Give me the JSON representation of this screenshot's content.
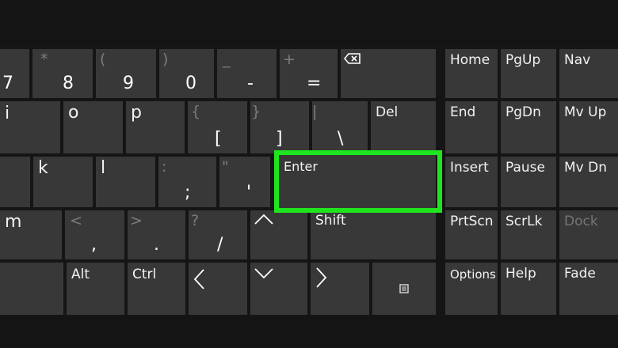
{
  "keys": {
    "seven": "7",
    "eight_top": "*",
    "eight": "8",
    "nine_top": "(",
    "nine": "9",
    "zero_top": ")",
    "zero": "0",
    "minus_top": "_",
    "minus": "-",
    "equals_top": "+",
    "equals": "=",
    "i": "i",
    "o": "o",
    "p": "p",
    "lbracket_top": "{",
    "lbracket": "[",
    "rbracket_top": "}",
    "rbracket": "]",
    "backslash_top": "|",
    "backslash": "\\",
    "del": "Del",
    "k": "k",
    "l": "l",
    "semicolon_top": ":",
    "semicolon": ";",
    "quote_top": "\"",
    "quote": "'",
    "enter": "Enter",
    "m": "m",
    "comma_top": "<",
    "comma": ",",
    "period_top": ">",
    "period": ".",
    "slash_top": "?",
    "slash": "/",
    "shift": "Shift",
    "alt": "Alt",
    "ctrl": "Ctrl"
  },
  "nav_keys": {
    "home": "Home",
    "pgup": "PgUp",
    "nav": "Nav",
    "end": "End",
    "pgdn": "PgDn",
    "mvup": "Mv Up",
    "insert": "Insert",
    "pause": "Pause",
    "mvdn": "Mv Dn",
    "prtscn": "PrtScn",
    "scrlk": "ScrLk",
    "dock": "Dock",
    "options": "Options",
    "help": "Help",
    "fade": "Fade"
  },
  "icons": {
    "backspace": "backspace-icon",
    "up": "arrow-up-icon",
    "left": "arrow-left-icon",
    "down": "arrow-down-icon",
    "right": "arrow-right-icon",
    "menu": "context-menu-icon"
  },
  "colors": {
    "key": "#383838",
    "background": "#151515",
    "highlight": "#1ee51e",
    "secondary_text": "#7c7c7c"
  }
}
